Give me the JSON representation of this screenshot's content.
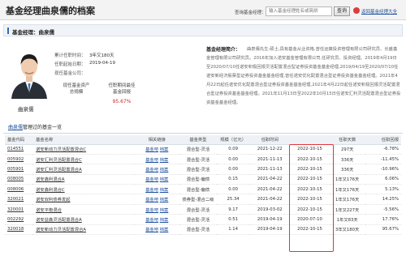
{
  "header": {
    "title": "基金经理曲泉儒的档案",
    "search_label": "查询基金经理：",
    "search_placeholder": "输入基金经理姓名或简拼",
    "search_button": "查询",
    "home_link": "返回基金经理大全"
  },
  "section": {
    "title": "基金经理：曲泉儒"
  },
  "manager": {
    "name": "曲泉儒",
    "info": [
      {
        "label": "累计任职时间：",
        "value": "3年又180天"
      },
      {
        "label": "任职起始日期：",
        "value": "2019-04-19"
      },
      {
        "label": "现任基金公司：",
        "value": ""
      }
    ],
    "metrics": [
      {
        "label_lines": [
          "现任基金资产",
          "总规模"
        ],
        "value": ""
      },
      {
        "label_lines": [
          "任职期间最佳",
          "基金回报"
        ],
        "value": "95.67%"
      }
    ],
    "bio_title": "基金经理简介：",
    "bio": "曲泉儒先生:硕士,具有基金从业资格,曾任远策投资管理有限公司研究员、长盛基金管理有限公司研究员。2016年加入诺安基金管理有限公司,任研究员、投资经理。2019年4月19日至2020/07/10任诺安积极回报灵活配置混合型证券投资基金基金经理,2019/04/19至2020/07/10任诺安新经济股票型证券投资基金基金经理,曾任诺安优化配置混合型证券投资基金基金经理。2021年4月22日起任诺安优化配置混合型证券投资基金基金经理,2021年4月22日起任诺安积极回报灵活配置混合型证券投资基金基金经理。2021年11月13日至2022年10月15日任诺安汇利灵活配置混合型证券投资基金基金经理。"
  },
  "funds_section": {
    "title_link": "曲泉儒",
    "title_rest": "管理过的基金一览"
  },
  "table": {
    "headers": [
      "基金代码",
      "基金名称",
      "相关链接",
      "基金类型",
      "规模（亿元）",
      "任职时间",
      "",
      "任职天数",
      "任职回报"
    ],
    "link_labels": [
      "基金吧",
      "档案"
    ],
    "rows": [
      {
        "code": "014551",
        "name": "诺安新动力灵活配置混合C",
        "type": "混合型-灵活",
        "size": "0.09",
        "start": "2021-12-22",
        "end": "2022-10-15",
        "days": "297天",
        "ret": "-6.78%",
        "dir": "down"
      },
      {
        "code": "005902",
        "name": "诺安汇利灵活配置混合C",
        "type": "混合型-灵活",
        "size": "0.00",
        "start": "2021-11-13",
        "end": "2022-10-15",
        "days": "336天",
        "ret": "-11.45%",
        "dir": "down"
      },
      {
        "code": "005901",
        "name": "诺安汇利灵活配置混合A",
        "type": "混合型-灵活",
        "size": "0.00",
        "start": "2021-11-13",
        "end": "2022-10-15",
        "days": "336天",
        "ret": "-10.96%",
        "dir": "down"
      },
      {
        "code": "008005",
        "name": "诺安鑫利混合A",
        "type": "混合型-偏债",
        "size": "0.15",
        "start": "2021-04-22",
        "end": "2022-10-15",
        "days": "1年又176天",
        "ret": "6.06%",
        "dir": "up"
      },
      {
        "code": "008006",
        "name": "诺安鑫利混合C",
        "type": "混合型-偏债",
        "size": "0.00",
        "start": "2021-04-22",
        "end": "2022-10-15",
        "days": "1年又176天",
        "ret": "5.13%",
        "dir": "up"
      },
      {
        "code": "320021",
        "name": "诺安双利债券发起",
        "type": "债券型-混合二级",
        "size": "25.34",
        "start": "2021-04-22",
        "end": "2022-10-15",
        "days": "1年又176天",
        "ret": "14.25%",
        "dir": "up"
      },
      {
        "code": "320001",
        "name": "诺安平衡混合",
        "type": "混合型-灵活",
        "size": "9.17",
        "start": "2019-03-02",
        "end": "2022-10-15",
        "days": "1年又227天",
        "ret": "-5.56%",
        "dir": "down"
      },
      {
        "code": "002292",
        "name": "诺安益鑫灵活配置混合A",
        "type": "混合型-灵活",
        "size": "0.51",
        "start": "2019-04-19",
        "end": "2020-07-10",
        "days": "1年又83天",
        "ret": "17.76%",
        "dir": "up"
      },
      {
        "code": "320018",
        "name": "诺安新动力灵活配置混合A",
        "type": "混合型-灵活",
        "size": "1.14",
        "start": "2019-04-19",
        "end": "2022-10-15",
        "days": "3年又180天",
        "ret": "95.67%",
        "dir": "up"
      }
    ]
  },
  "colors": {
    "accent": "#1d4f9c",
    "up": "#d0232a",
    "down": "#1f9c3b",
    "highlight_box": "#e0343a"
  }
}
